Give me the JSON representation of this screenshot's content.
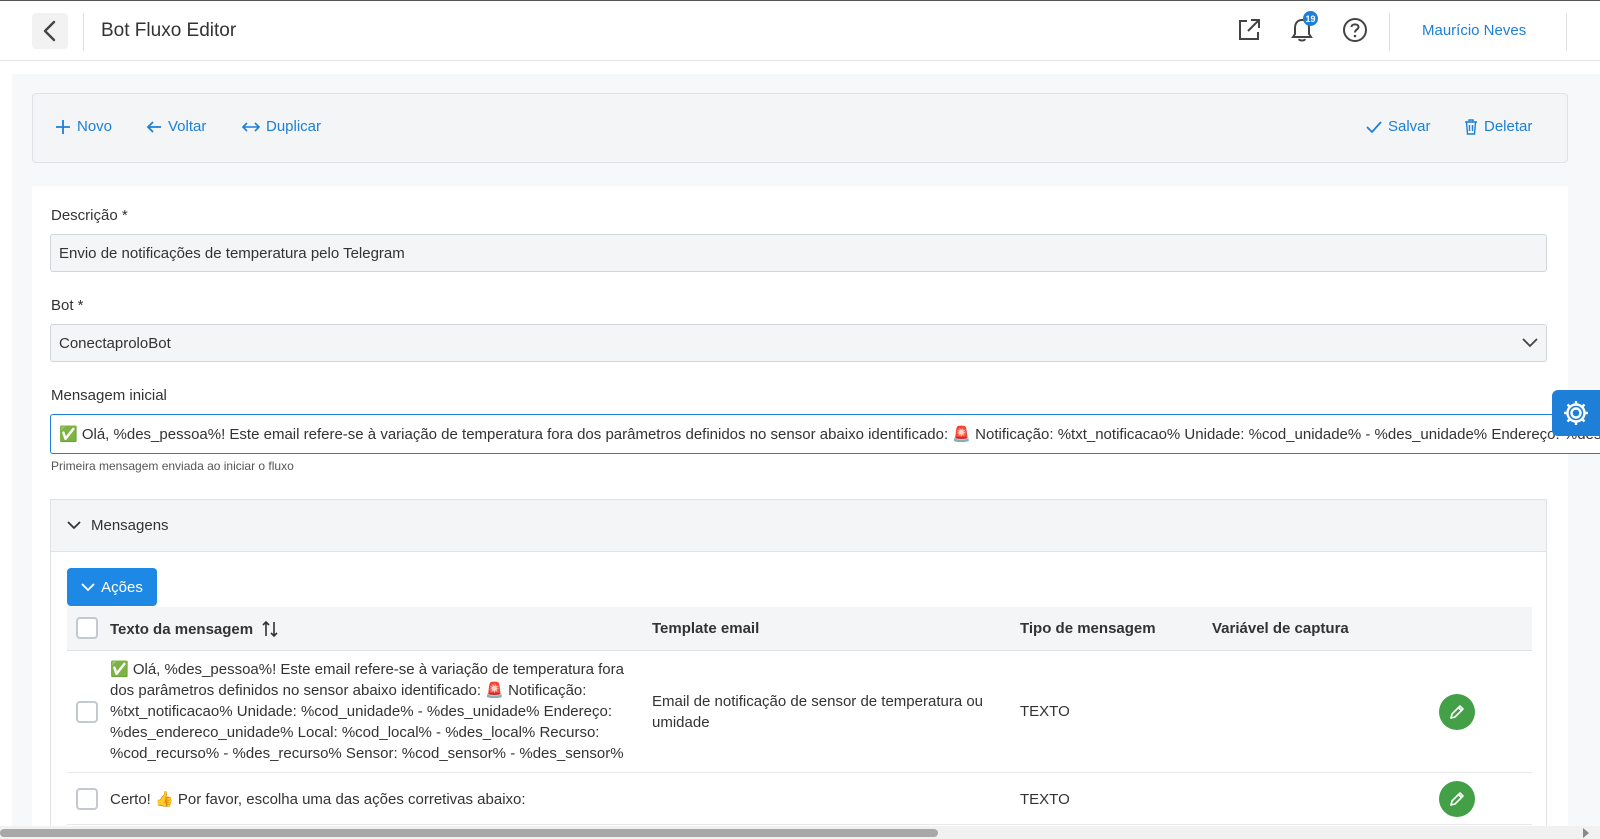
{
  "header": {
    "title": "Bot Fluxo Editor",
    "notification_count": "19",
    "user_name": "Maurício Neves"
  },
  "toolbar": {
    "novo": "Novo",
    "voltar": "Voltar",
    "duplicar": "Duplicar",
    "salvar": "Salvar",
    "deletar": "Deletar"
  },
  "form": {
    "descricao_label": "Descrição *",
    "descricao_value": "Envio de notificações de temperatura pelo Telegram",
    "bot_label": "Bot *",
    "bot_value": "ConectaproloBot",
    "mensagem_label": "Mensagem inicial",
    "mensagem_value": "✅ Olá, %des_pessoa%! Este email refere-se à variação de temperatura fora dos parâmetros definidos no sensor abaixo identificado: 🚨 Notificação: %txt_notificacao% Unidade: %cod_unidade% - %des_unidade% Endereço: %des_endereco_unidade%",
    "mensagem_hint": "Primeira mensagem enviada ao iniciar o fluxo"
  },
  "mensagens": {
    "section_title": "Mensagens",
    "acoes_label": "Ações",
    "columns": [
      "Texto da mensagem",
      "Template email",
      "Tipo de mensagem",
      "Variável de captura"
    ],
    "rows": [
      {
        "texto": "✅ Olá, %des_pessoa%! Este email refere-se à variação de temperatura fora dos parâmetros definidos no sensor abaixo identificado: 🚨 Notificação: %txt_notificacao% Unidade: %cod_unidade% - %des_unidade% Endereço: %des_endereco_unidade% Local: %cod_local% - %des_local% Recurso: %cod_recurso% - %des_recurso% Sensor: %cod_sensor% - %des_sensor%",
        "template": "Email de notificação de sensor de temperatura ou umidade",
        "tipo": "TEXTO",
        "variavel": ""
      },
      {
        "texto": "Certo! 👍 Por favor, escolha uma das ações corretivas abaixo:",
        "template": "",
        "tipo": "TEXTO",
        "variavel": ""
      }
    ]
  },
  "icons": {
    "back": "chevron-left-icon",
    "external": "external-link-icon",
    "bell": "bell-icon",
    "help": "question-circle-icon",
    "settings": "gear-icon",
    "edit": "pencil-icon"
  },
  "colors": {
    "primary": "#1d7fd8",
    "button": "#1e88e5",
    "edit": "#43a047"
  }
}
